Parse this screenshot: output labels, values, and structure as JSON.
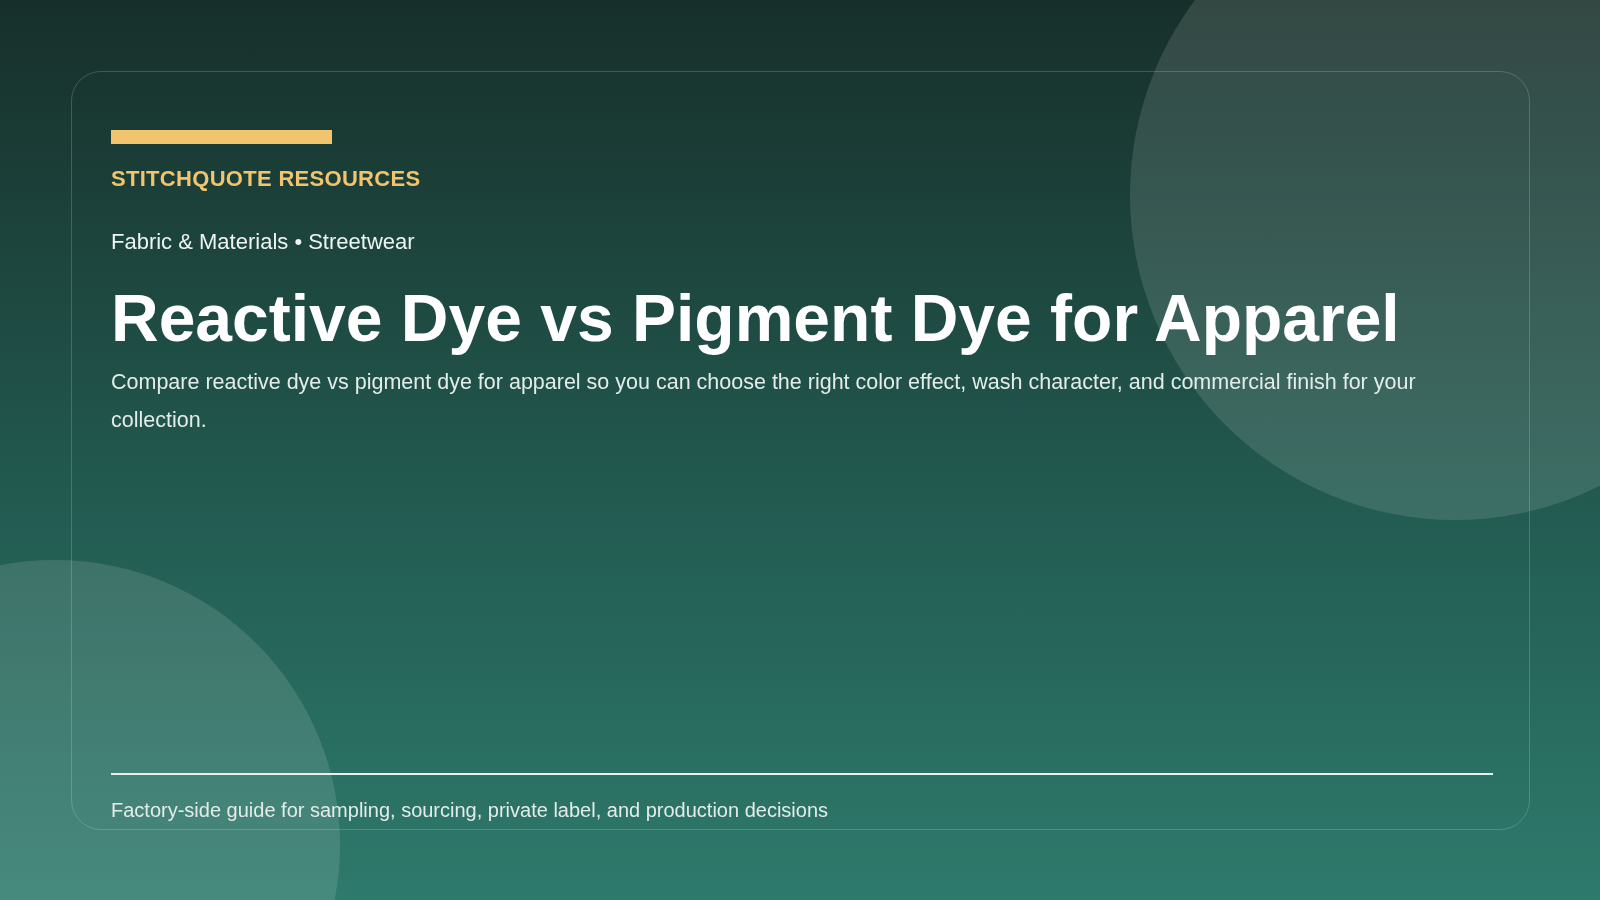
{
  "kicker": "STITCHQUOTE RESOURCES",
  "meta": "Fabric & Materials • Streetwear",
  "title": "Reactive Dye vs Pigment Dye for Apparel",
  "description": "Compare reactive dye vs pigment dye for apparel so you can choose the right color effect, wash character, and commercial finish for your collection.",
  "footer": "Factory-side guide for sampling, sourcing, private label, and production decisions"
}
